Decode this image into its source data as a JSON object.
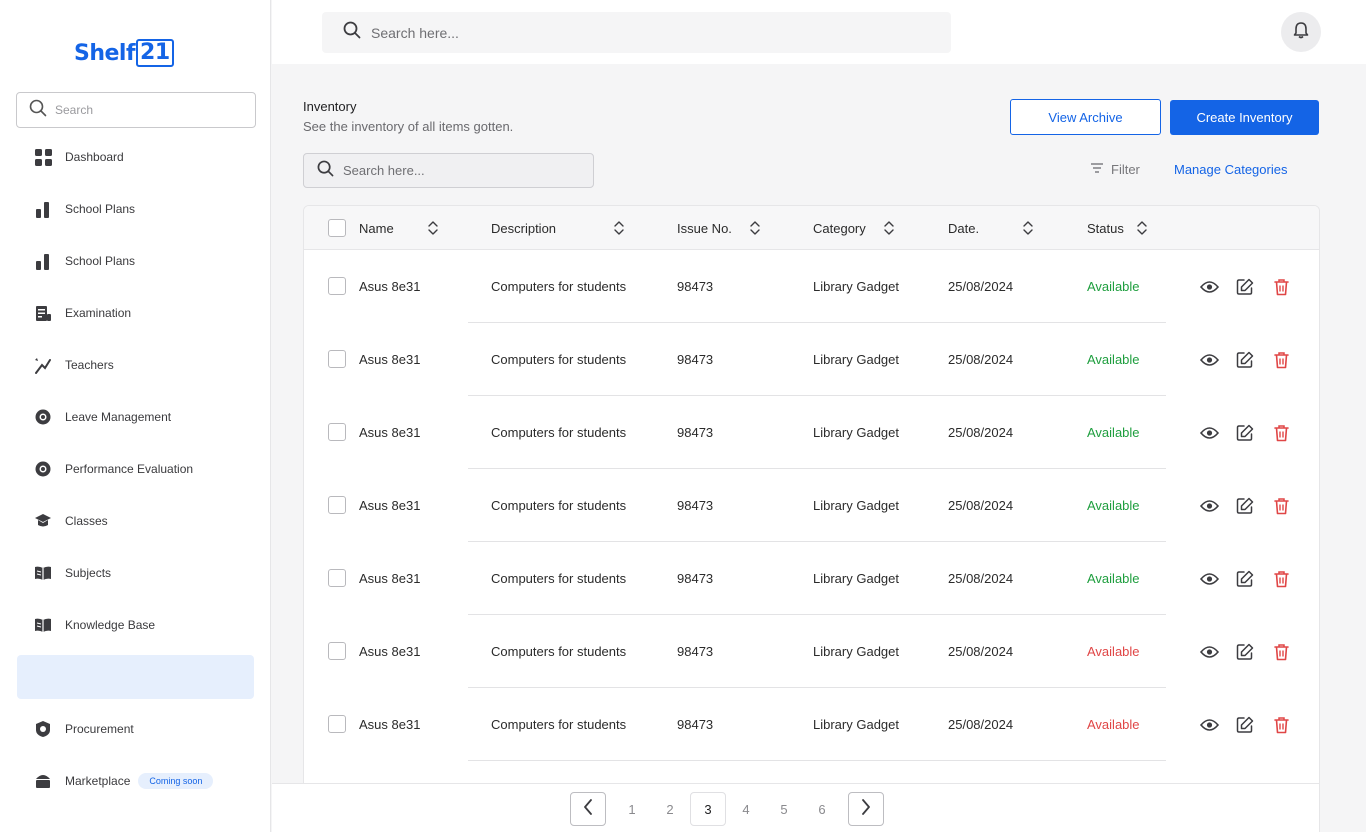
{
  "brand": {
    "name": "Shelf",
    "number": "21"
  },
  "sidebar": {
    "search_placeholder": "Search",
    "items": [
      {
        "label": "Dashboard",
        "icon": "dashboard-icon"
      },
      {
        "label": "School Plans",
        "icon": "bar-chart-icon"
      },
      {
        "label": "School Plans",
        "icon": "bar-chart-icon"
      },
      {
        "label": "Examination",
        "icon": "exam-icon"
      },
      {
        "label": "Teachers",
        "icon": "teacher-icon"
      },
      {
        "label": "Leave Management",
        "icon": "lifebuoy-icon"
      },
      {
        "label": "Performance Evaluation",
        "icon": "lifebuoy-icon"
      },
      {
        "label": "Classes",
        "icon": "graduation-cap-icon"
      },
      {
        "label": "Subjects",
        "icon": "open-book-icon"
      },
      {
        "label": "Knowledge Base",
        "icon": "open-book-icon"
      },
      {
        "label": "",
        "icon": ""
      },
      {
        "label": "Procurement",
        "icon": "procurement-icon"
      },
      {
        "label": "Marketplace",
        "icon": "marketplace-icon",
        "badge": "Coming soon"
      }
    ]
  },
  "header": {
    "search_placeholder": "Search here..."
  },
  "main": {
    "title": "Inventory",
    "subtitle": "See the inventory of all items gotten.",
    "view_archive_label": "View Archive",
    "create_label": "Create Inventory",
    "search_placeholder": "Search here...",
    "filter_label": "Filter",
    "manage_label": "Manage Categories"
  },
  "table": {
    "columns": [
      "Name",
      "Description",
      "Issue No.",
      "Category",
      "Date.",
      "Status"
    ],
    "rows": [
      {
        "name": "Asus 8e31",
        "description": "Computers for students",
        "issue_no": "98473",
        "category": "Library Gadget",
        "date": "25/08/2024",
        "status": "Available",
        "status_color": "#1e9e3e"
      },
      {
        "name": "Asus 8e31",
        "description": "Computers for students",
        "issue_no": "98473",
        "category": "Library Gadget",
        "date": "25/08/2024",
        "status": "Available",
        "status_color": "#1e9e3e"
      },
      {
        "name": "Asus 8e31",
        "description": "Computers for students",
        "issue_no": "98473",
        "category": "Library Gadget",
        "date": "25/08/2024",
        "status": "Available",
        "status_color": "#1e9e3e"
      },
      {
        "name": "Asus 8e31",
        "description": "Computers for students",
        "issue_no": "98473",
        "category": "Library Gadget",
        "date": "25/08/2024",
        "status": "Available",
        "status_color": "#1e9e3e"
      },
      {
        "name": "Asus 8e31",
        "description": "Computers for students",
        "issue_no": "98473",
        "category": "Library Gadget",
        "date": "25/08/2024",
        "status": "Available",
        "status_color": "#1e9e3e"
      },
      {
        "name": "Asus 8e31",
        "description": "Computers for students",
        "issue_no": "98473",
        "category": "Library Gadget",
        "date": "25/08/2024",
        "status": "Available",
        "status_color": "#e04646"
      },
      {
        "name": "Asus 8e31",
        "description": "Computers for students",
        "issue_no": "98473",
        "category": "Library Gadget",
        "date": "25/08/2024",
        "status": "Available",
        "status_color": "#e04646"
      }
    ]
  },
  "pagination": {
    "pages": [
      "1",
      "2",
      "3",
      "4",
      "5",
      "6"
    ],
    "current": "3"
  },
  "colors": {
    "accent": "#1464e6",
    "available_green": "#1e9e3e",
    "available_red": "#e04646",
    "delete_red": "#e04646"
  }
}
